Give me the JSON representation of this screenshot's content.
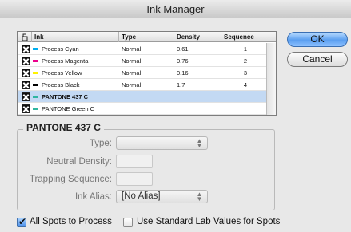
{
  "window": {
    "title": "Ink Manager"
  },
  "table": {
    "columns": {
      "icon": "spot-ink-icon",
      "ink": "Ink",
      "type": "Type",
      "density": "Density",
      "sequence": "Sequence"
    },
    "rows": [
      {
        "name": "Process Cyan",
        "type": "Normal",
        "density": "0.61",
        "sequence": "1",
        "swatch": "#00aeef",
        "selected": false
      },
      {
        "name": "Process Magenta",
        "type": "Normal",
        "density": "0.76",
        "sequence": "2",
        "swatch": "#ec008c",
        "selected": false
      },
      {
        "name": "Process Yellow",
        "type": "Normal",
        "density": "0.16",
        "sequence": "3",
        "swatch": "#fff200",
        "selected": false
      },
      {
        "name": "Process Black",
        "type": "Normal",
        "density": "1.7",
        "sequence": "4",
        "swatch": "#000000",
        "selected": false
      },
      {
        "name": "PANTONE 437 C",
        "type": "",
        "density": "",
        "sequence": "",
        "swatch": "#2fb5a0",
        "selected": true
      },
      {
        "name": "PANTONE Green C",
        "type": "",
        "density": "",
        "sequence": "",
        "swatch": "#2fb5a0",
        "selected": false
      }
    ]
  },
  "buttons": {
    "ok": "OK",
    "cancel": "Cancel"
  },
  "details": {
    "title": "PANTONE 437 C",
    "type_label": "Type:",
    "type_value": "",
    "neutral_density_label": "Neutral Density:",
    "neutral_density_value": "",
    "trapping_sequence_label": "Trapping Sequence:",
    "trapping_sequence_value": "",
    "ink_alias_label": "Ink Alias:",
    "ink_alias_value": "[No Alias]"
  },
  "options": {
    "all_spots_to_process": {
      "label": "All Spots to Process",
      "checked": true
    },
    "use_standard_lab": {
      "label": "Use Standard Lab Values for Spots",
      "checked": false
    }
  },
  "colors": {
    "selected_row": "#c3d9f3",
    "ok_button": "#5a9ef0"
  }
}
